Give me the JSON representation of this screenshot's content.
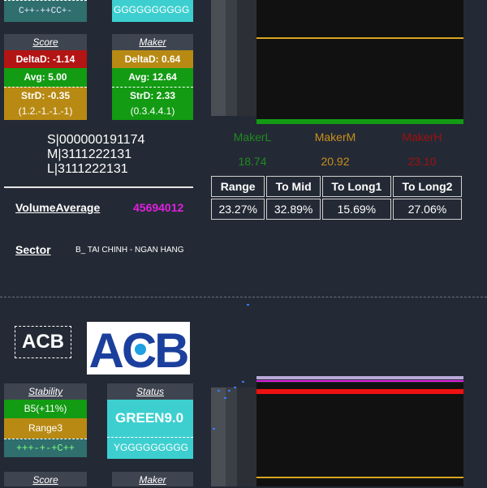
{
  "top": {
    "stability_strip_text": "C++-++CC+-",
    "status_strip_text": "GGGGGGGGGG",
    "score": {
      "header": "Score",
      "deltad": "DeltaD: -1.14",
      "avg": "Avg: 5.00",
      "strd": "StrD: -0.35",
      "strd_detail": "(1.2.-1.-1.-1)"
    },
    "maker": {
      "header": "Maker",
      "deltad": "DeltaD: 0.64",
      "avg": "Avg: 12.64",
      "strd": "StrD: 2.33",
      "strd_detail": "(0.3.4.4.1)"
    },
    "codes": [
      "S|000000191174",
      "M|3111222131",
      "L|3111222131"
    ],
    "volume_label": "VolumeAverage",
    "volume_value": "45694012",
    "sector_label": "Sector",
    "sector_value": "B_ TAI CHINH - NGAN HANG",
    "makers": [
      {
        "label": "MakerL",
        "value": "18.74"
      },
      {
        "label": "MakerM",
        "value": "20.92"
      },
      {
        "label": "MakerH",
        "value": "23.10"
      }
    ],
    "stats": {
      "headers": [
        "Range",
        "To Mid",
        "To Long1",
        "To Long2"
      ],
      "values": [
        "23.27%",
        "32.89%",
        "15.69%",
        "27.06%"
      ]
    }
  },
  "bottom": {
    "ticker": "ACB",
    "logo_text": "ACB",
    "stability": {
      "header": "Stability",
      "value": "B5(+11%)",
      "range": "Range3",
      "strip": "+++-+-+C++"
    },
    "status": {
      "header": "Status",
      "value": "GREEN9.0",
      "strip": "YGGGGGGGGG"
    },
    "score_header": "Score",
    "maker_header": "Maker"
  },
  "colors": {
    "background": "#242a35",
    "red": "#b31414",
    "green": "#139b13",
    "gold": "#b88a13",
    "cyan": "#3dcfd0",
    "magenta": "#e020e0",
    "maker_l": "#1f8a1f",
    "maker_m": "#c98f1a",
    "maker_h": "#a01010",
    "chart_line_gold": "#d9a520"
  }
}
